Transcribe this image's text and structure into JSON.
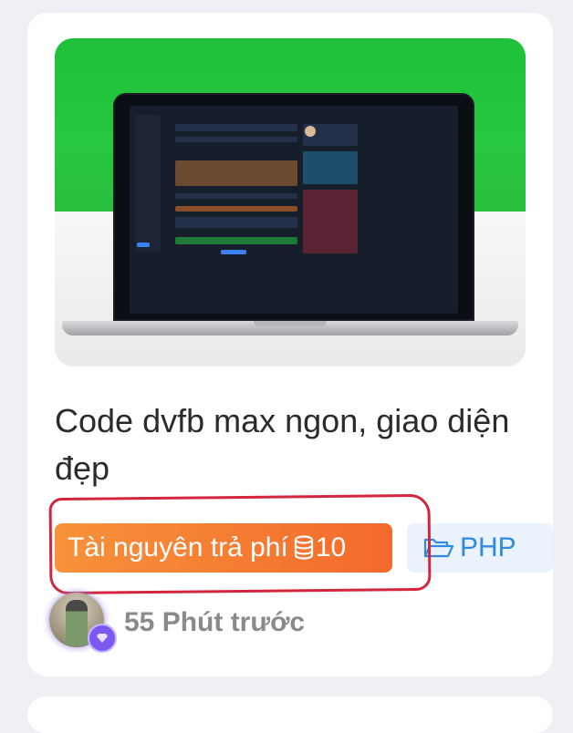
{
  "post": {
    "title": "Code dvfb max ngon, giao diện đẹp",
    "paid_label": "Tài nguyên trả phí",
    "price": "10",
    "category": "PHP",
    "time_ago": "55 Phút trước"
  },
  "icons": {
    "coin": "coins-stack-icon",
    "folder": "folder-open-icon",
    "badge": "diamond-icon"
  },
  "colors": {
    "paid_badge": "#f36a2c",
    "category_text": "#2f8ae0",
    "highlight_circle": "#d3263e",
    "thumbnail_bg": "#27c83f"
  }
}
